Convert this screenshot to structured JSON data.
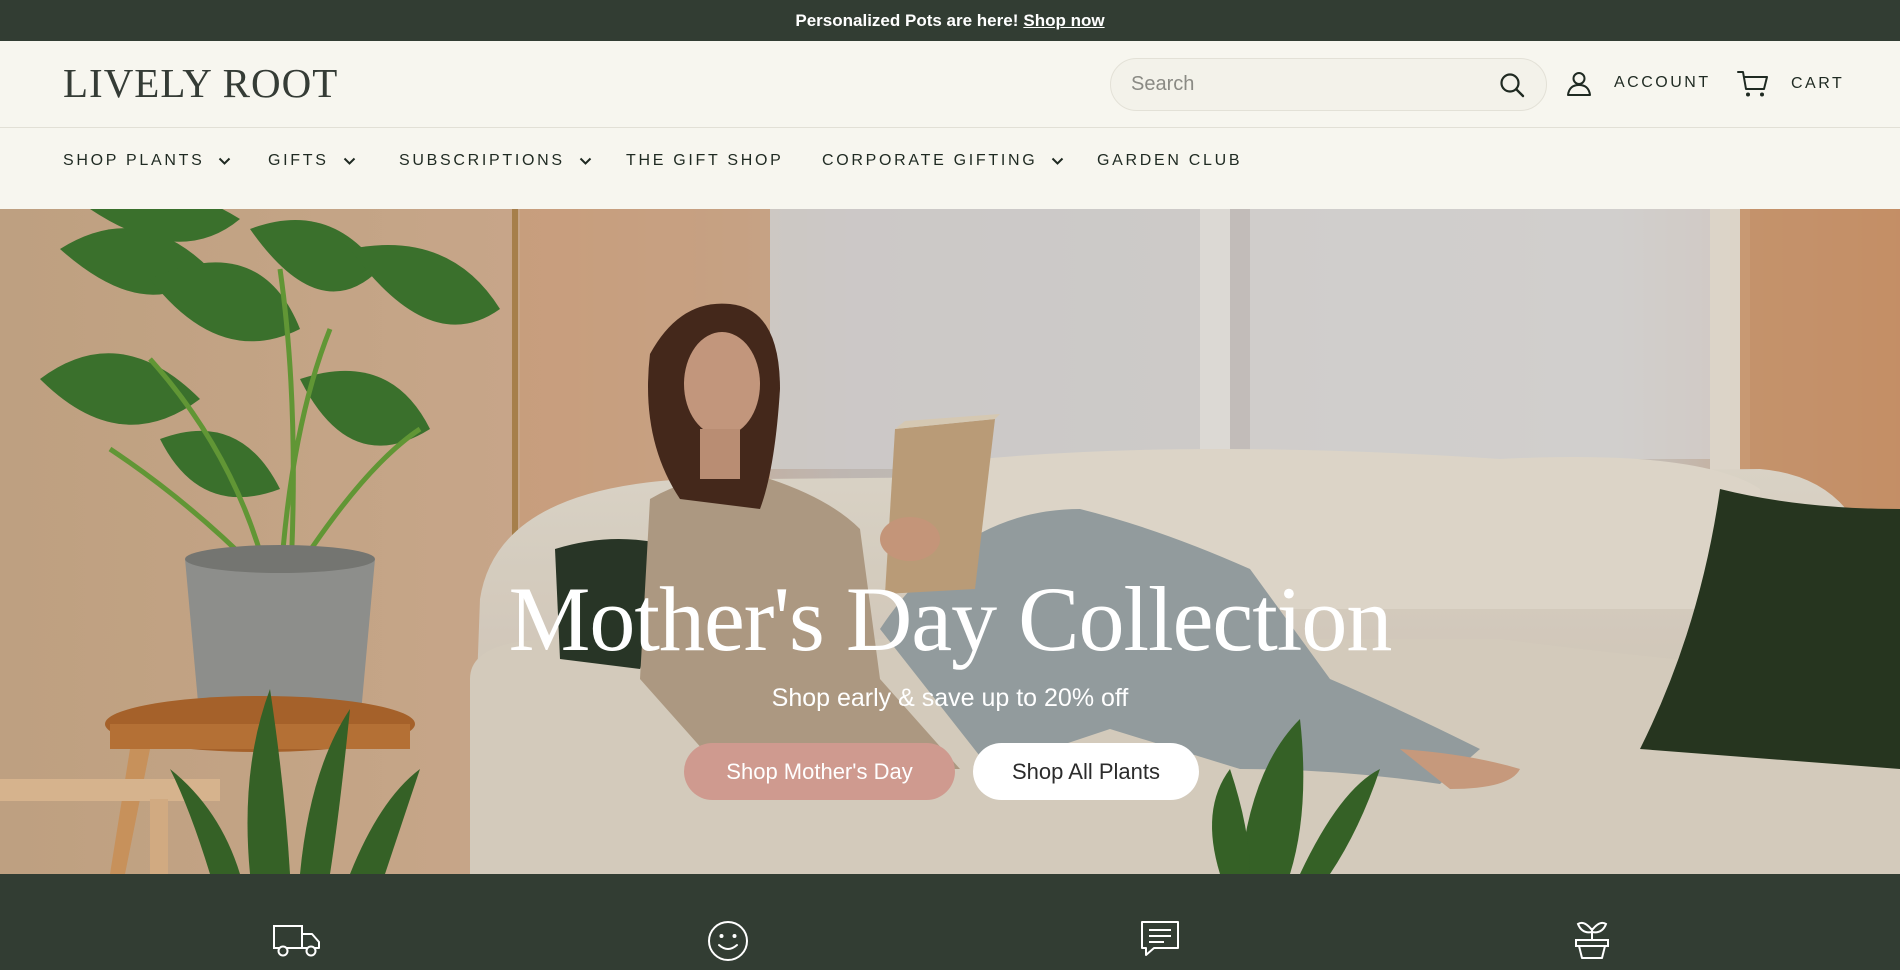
{
  "announcement": {
    "text": "Personalized Pots are here!",
    "link": "Shop now"
  },
  "header": {
    "logo": "LIVELY ROOT",
    "search_placeholder": "Search",
    "account_label": "ACCOUNT",
    "cart_label": "CART"
  },
  "nav": {
    "items": [
      {
        "label": "SHOP PLANTS",
        "has_dropdown": true
      },
      {
        "label": "GIFTS",
        "has_dropdown": true
      },
      {
        "label": "SUBSCRIPTIONS",
        "has_dropdown": true
      },
      {
        "label": "THE GIFT SHOP",
        "has_dropdown": false
      },
      {
        "label": "CORPORATE GIFTING",
        "has_dropdown": true
      },
      {
        "label": "GARDEN CLUB",
        "has_dropdown": false
      }
    ]
  },
  "hero": {
    "title": "Mother's Day Collection",
    "subtitle": "Shop early & save up to 20% off",
    "primary_button": "Shop Mother's Day",
    "secondary_button": "Shop All Plants"
  },
  "features": {
    "icons": [
      "truck-icon",
      "smiley-icon",
      "chat-icon",
      "plant-pot-icon"
    ]
  },
  "colors": {
    "dark_green": "#323d33",
    "cream": "#f7f6ef",
    "accent_pink": "#cf9a8f"
  }
}
